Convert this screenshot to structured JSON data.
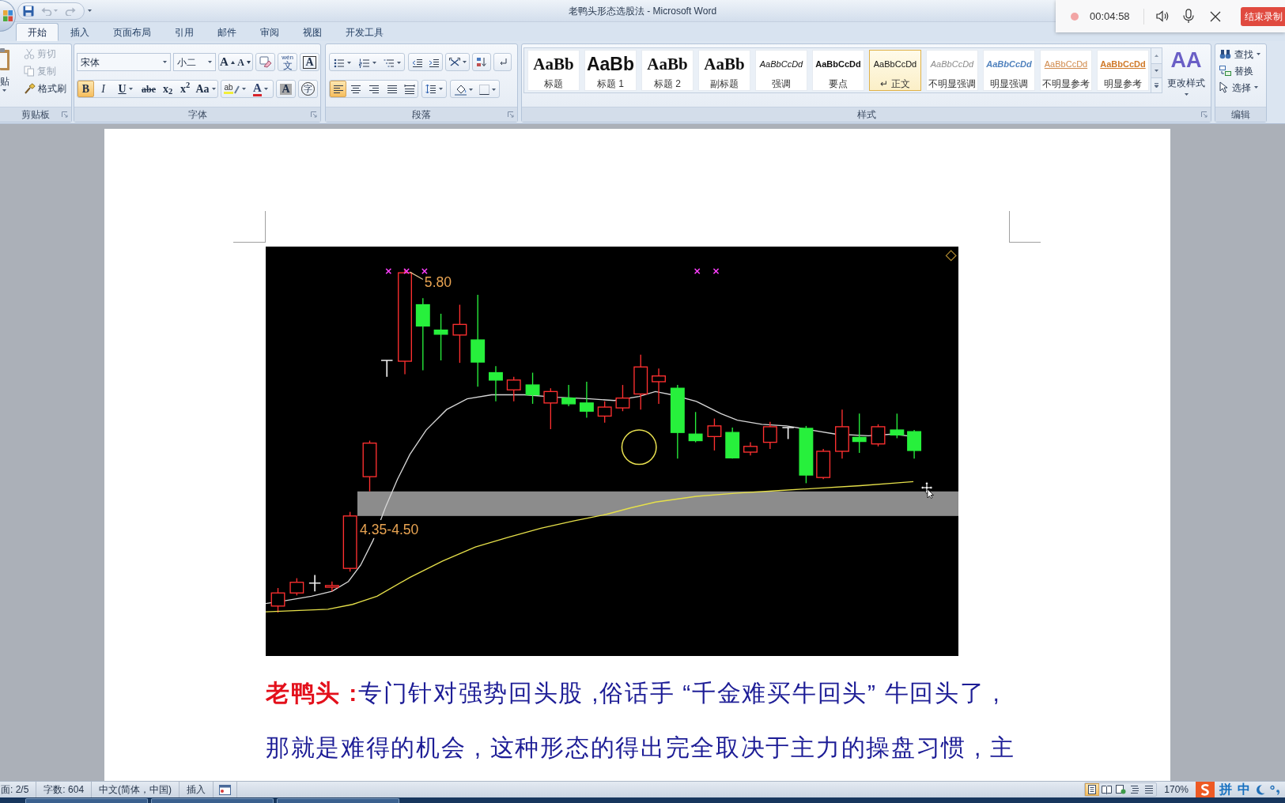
{
  "window": {
    "title": "老鸭头形态选股法 - Microsoft Word"
  },
  "quick_access": [
    {
      "kind": "save",
      "disabled": false
    },
    {
      "kind": "undo",
      "disabled": true
    },
    {
      "kind": "redo",
      "disabled": true
    }
  ],
  "recorder": {
    "time": "00:04:58",
    "stop_button": "结束录制"
  },
  "tabs": [
    {
      "label": "开始",
      "selected": true
    },
    {
      "label": "插入",
      "selected": false
    },
    {
      "label": "页面布局",
      "selected": false
    },
    {
      "label": "引用",
      "selected": false
    },
    {
      "label": "邮件",
      "selected": false
    },
    {
      "label": "审阅",
      "selected": false
    },
    {
      "label": "视图",
      "selected": false
    },
    {
      "label": "开发工具",
      "selected": false
    }
  ],
  "clipboard": {
    "paste_label": "贴",
    "items": [
      {
        "kind": "cut",
        "label": "剪切",
        "disabled": true
      },
      {
        "kind": "copy",
        "label": "复制",
        "disabled": true
      },
      {
        "kind": "format_painter",
        "label": "格式刷",
        "disabled": false
      }
    ],
    "group_label": "剪贴板"
  },
  "font": {
    "font_name": "宋体",
    "font_size": "小二",
    "row_1": [
      {
        "kind": "grow",
        "label": "A"
      },
      {
        "kind": "shrink",
        "label": "A"
      },
      {
        "kind": "clear"
      },
      {
        "kind": "phonetic",
        "label": "文",
        "ruby": "wén"
      },
      {
        "kind": "border",
        "label": "A"
      }
    ],
    "row_2": [
      {
        "kind": "bold",
        "label": "B",
        "selected": true
      },
      {
        "kind": "italic",
        "label": "I",
        "selected": false
      },
      {
        "kind": "underline",
        "label": "U",
        "selected": false
      },
      {
        "kind": "strike",
        "label": "abe",
        "selected": false
      },
      {
        "kind": "subscript",
        "label": "x$_{2}$",
        "selected": false
      },
      {
        "kind": "superscript",
        "label": "x$^{2}$",
        "selected": false
      },
      {
        "kind": "case",
        "label": "Aa",
        "selected": false
      },
      {
        "kind": "highlight",
        "label": "ab",
        "selected": false
      },
      {
        "kind": "color",
        "label": "A",
        "selected": false
      },
      {
        "kind": "shading",
        "label": "A",
        "selected": false
      },
      {
        "kind": "enclose",
        "label": "字",
        "selected": false
      }
    ],
    "group_label": "字体"
  },
  "paragraph": {
    "alignment": [
      {
        "kind": "left",
        "selected": true
      },
      {
        "kind": "center",
        "selected": false
      },
      {
        "kind": "right",
        "selected": false
      },
      {
        "kind": "justify",
        "selected": false
      },
      {
        "kind": "distributed",
        "selected": false
      }
    ],
    "group_label": "段落"
  },
  "styles": {
    "items": [
      {
        "kind": "title",
        "preview": "AaBb",
        "label": "标题",
        "selected": false
      },
      {
        "kind": "heading_1",
        "preview": "AaBb",
        "label": "标题 1",
        "selected": false
      },
      {
        "kind": "heading_2",
        "preview": "AaBb",
        "label": "标题 2",
        "selected": false
      },
      {
        "kind": "subtitle",
        "preview": "AaBb",
        "label": "副标题",
        "selected": false
      },
      {
        "kind": "emphasis",
        "preview": "AaBbCcDd",
        "label": "强调",
        "selected": false
      },
      {
        "kind": "strong",
        "preview": "AaBbCcDd",
        "label": "要点",
        "selected": false
      },
      {
        "kind": "normal",
        "preview": "AaBbCcDd",
        "label": "↵ 正文",
        "selected": true
      },
      {
        "kind": "subtle_emphasis",
        "preview": "AaBbCcDd",
        "label": "不明显强调",
        "selected": false
      },
      {
        "kind": "intense_emphasis",
        "preview": "AaBbCcDd",
        "label": "明显强调",
        "selected": false
      },
      {
        "kind": "subtle_reference",
        "preview": "AaBbCcDd",
        "label": "不明显参考",
        "selected": false
      },
      {
        "kind": "intense_reference",
        "preview": "AaBbCcDd",
        "label": "明显参考",
        "selected": false
      }
    ],
    "change_styles": {
      "glyph": "AA",
      "label": "更改样式"
    },
    "group_label": "样式"
  },
  "editing": {
    "items": [
      {
        "kind": "find",
        "label": "查找"
      },
      {
        "kind": "replace",
        "label": "替换"
      },
      {
        "kind": "select",
        "label": "选择"
      }
    ],
    "group_label": "编辑"
  },
  "document": {
    "chart": {
      "peak_label": "5.80",
      "range_label": "4.35-4.50"
    },
    "paragraph": {
      "lead": "老鸭头 :",
      "lines": [
        "专门针对强势回头股 ,俗话手 “千金难买牛回头” 牛回头了 ,",
        "那就是难得的机会 , 这种形态的得出完全取决于主力的操盘习惯 , 主"
      ]
    }
  },
  "status_bar": {
    "items": [
      "面: 2/5",
      "字数: 604",
      "中文(简体，中国)",
      "插入"
    ],
    "views": [
      {
        "kind": "print_layout",
        "selected": true
      },
      {
        "kind": "full_screen_reading",
        "selected": false
      },
      {
        "kind": "web_layout",
        "selected": false
      },
      {
        "kind": "outline",
        "selected": false
      },
      {
        "kind": "draft",
        "selected": false
      }
    ],
    "zoom": "170%"
  },
  "ime": {
    "mode": "拼",
    "language": "中"
  }
}
